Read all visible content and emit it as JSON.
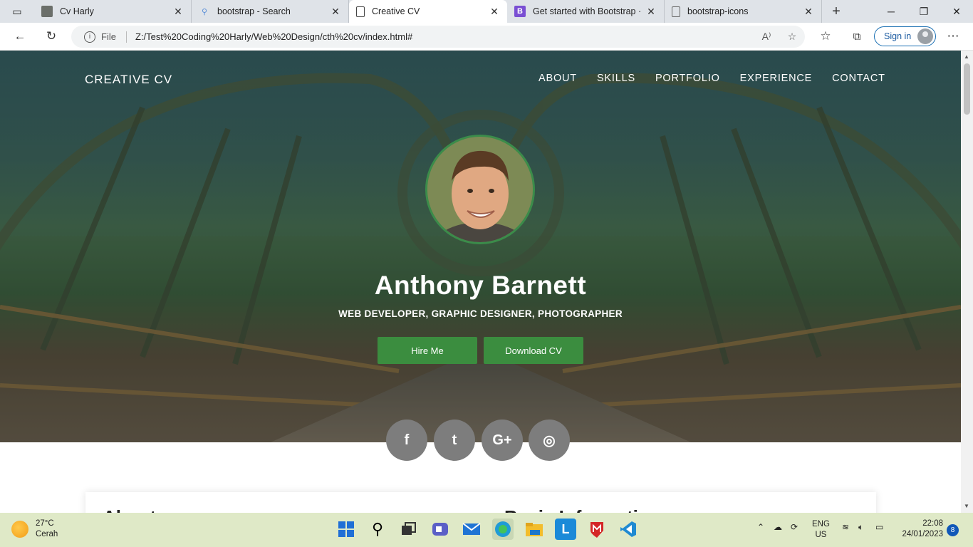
{
  "browser": {
    "tabs": [
      {
        "title": "Cv Harly",
        "icon": "photo-favicon"
      },
      {
        "title": "bootstrap - Search",
        "icon": "search-favicon"
      },
      {
        "title": "Creative CV",
        "icon": "page-favicon",
        "active": true
      },
      {
        "title": "Get started with Bootstrap · B",
        "icon": "bootstrap-favicon"
      },
      {
        "title": "bootstrap-icons",
        "icon": "page-favicon"
      }
    ],
    "address": {
      "scheme": "File",
      "url": "Z:/Test%20Coding%20Harly/Web%20Design/cth%20cv/index.html#"
    },
    "signin_label": "Sign in"
  },
  "site": {
    "brand": "CREATIVE CV",
    "nav": [
      "ABOUT",
      "SKILLS",
      "PORTFOLIO",
      "EXPERIENCE",
      "CONTACT"
    ],
    "name": "Anthony Barnett",
    "subtitle": "WEB DEVELOPER, GRAPHIC DESIGNER, PHOTOGRAPHER",
    "buttons": {
      "hire": "Hire Me",
      "download": "Download CV"
    },
    "social": [
      {
        "icon": "facebook-icon",
        "glyph": "f"
      },
      {
        "icon": "twitter-icon",
        "glyph": "t"
      },
      {
        "icon": "google-plus-icon",
        "glyph": "G+"
      },
      {
        "icon": "instagram-icon",
        "glyph": "◎"
      }
    ],
    "card_headings": [
      "About",
      "Basic Information"
    ],
    "accent_color": "#3b8d3f"
  },
  "taskbar": {
    "weather": {
      "temp": "27°C",
      "condition": "Cerah"
    },
    "language": {
      "lang": "ENG",
      "region": "US"
    },
    "time": "22:08",
    "date": "24/01/2023",
    "notifications": "8"
  }
}
